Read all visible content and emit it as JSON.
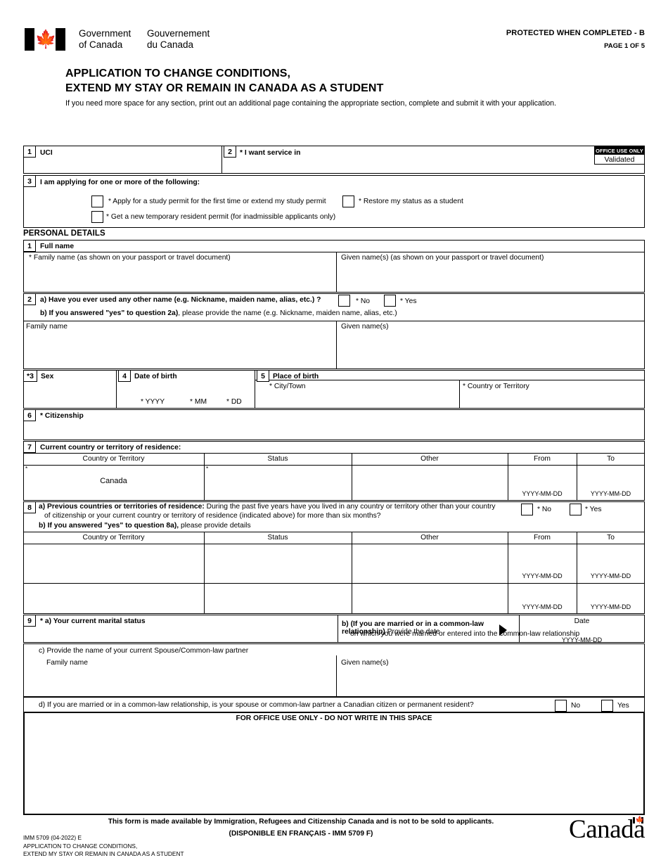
{
  "header": {
    "gov_en_line1": "Government",
    "gov_en_line2": "of Canada",
    "gov_fr_line1": "Gouvernement",
    "gov_fr_line2": "du Canada",
    "protected": "PROTECTED WHEN COMPLETED - B",
    "page_of": "PAGE 1 OF 5",
    "title_line1": "APPLICATION TO CHANGE CONDITIONS,",
    "title_line2": "EXTEND MY STAY OR REMAIN IN CANADA AS A STUDENT",
    "subnote": "If you need more space for any section, print out an additional page containing the appropriate section, complete and submit it with your application."
  },
  "office_use": {
    "strip": "OFFICE USE ONLY",
    "value": "Validated"
  },
  "top": {
    "q1_num": "1",
    "q1_label": "UCI",
    "q1_value": "",
    "q2_num": "2",
    "q2_label": "* I want service in",
    "q2_value": "",
    "q3_num": "3",
    "q3_label": "I am applying for one or more of the following:",
    "q3_options": [
      "* Apply for a study permit for the first time or extend my study permit",
      "* Restore my status as a student",
      "* Get a new temporary resident permit (for inadmissible applicants only)"
    ]
  },
  "personal_details": {
    "section_heading": "PERSONAL DETAILS",
    "q1": {
      "num": "1",
      "label": "Full name",
      "family_label": "* Family name (as shown on your passport or travel document)",
      "family_value": "",
      "given_label": "Given name(s) (as shown on your passport or travel document)",
      "given_value": ""
    },
    "q2": {
      "num": "2",
      "a_text": "a) Have you ever used any other name (e.g. Nickname, maiden name, alias, etc.) ?",
      "no_label": "* No",
      "yes_label": "* Yes",
      "b_bold": "b) If you answered \"yes\" to question 2a)",
      "b_rest": ", please provide the name (e.g. Nickname, maiden name, alias, etc.)",
      "family_label": "Family name",
      "family_value": "",
      "given_label": "Given name(s)",
      "given_value": ""
    },
    "q3": {
      "num": "*3",
      "label": "Sex",
      "value": ""
    },
    "q4": {
      "num": "4",
      "label": "Date of birth",
      "yyyy": "* YYYY",
      "mm": "* MM",
      "dd": "* DD",
      "yyyy_value": "",
      "mm_value": "",
      "dd_value": ""
    },
    "q5": {
      "num": "5",
      "label": "Place of birth",
      "city_label": "* City/Town",
      "city_value": "",
      "country_label": "* Country or Territory",
      "country_value": ""
    },
    "q6": {
      "num": "6",
      "label": "* Citizenship",
      "value": ""
    },
    "q7": {
      "num": "7",
      "label": "Current country or territory of residence:",
      "columns": [
        "Country or Territory",
        "Status",
        "Other",
        "From",
        "To"
      ],
      "row": {
        "country": "Canada",
        "status": "",
        "other": "",
        "from": "",
        "to": "",
        "from_hint": "YYYY-MM-DD",
        "to_hint": "YYYY-MM-DD"
      }
    },
    "q8": {
      "num": "8",
      "a_bold": "a) Previous countries or territories of residence:",
      "a_rest_line1": " During the past five years have you lived in any country or territory other than your country",
      "a_line2": "of citizenship or your current country or territory of residence (indicated above) for more than six months?",
      "no_label": "* No",
      "yes_label": "* Yes",
      "b_bold": "b) If you answered \"yes\" to question 8a),",
      "b_rest": " please provide details",
      "columns": [
        "Country or Territory",
        "Status",
        "Other",
        "From",
        "To"
      ],
      "rows": [
        {
          "country": "",
          "status": "",
          "other": "",
          "from": "",
          "to": "",
          "from_hint": "YYYY-MM-DD",
          "to_hint": "YYYY-MM-DD"
        },
        {
          "country": "",
          "status": "",
          "other": "",
          "from": "",
          "to": "",
          "from_hint": "YYYY-MM-DD",
          "to_hint": "YYYY-MM-DD"
        }
      ]
    },
    "q9": {
      "num": "9",
      "a_label": "* a) Your current marital status",
      "a_value": "",
      "b_bold": "b) (If you are married or in a common-law relationship)",
      "b_rest1": " Provide the date",
      "b_line2": "on which you were married or entered into the common-law relationship",
      "date_label": "Date",
      "date_value": "",
      "date_hint": "YYYY-MM-DD",
      "c_label": "c) Provide the name of your current Spouse/Common-law partner",
      "c_family_label": "Family name",
      "c_family_value": "",
      "c_given_label": "Given name(s)",
      "c_given_value": "",
      "d_label": "d) If you are married or in a common-law relationship, is your spouse or common-law partner a Canadian citizen or permanent resident?",
      "d_no": "No",
      "d_yes": "Yes"
    }
  },
  "office_block": {
    "title": "FOR OFFICE USE ONLY - DO NOT WRITE IN THIS SPACE"
  },
  "footer": {
    "line1": "This form is made available by Immigration, Refugees and Citizenship Canada and is not to be sold to applicants.",
    "line2": "(DISPONIBLE EN FRANÇAIS - IMM 5709 F)",
    "id_line1": "IMM 5709 (04-2022) E",
    "id_line2": "APPLICATION TO CHANGE CONDITIONS,",
    "id_line3": "EXTEND MY STAY OR REMAIN IN CANADA AS A STUDENT",
    "wordmark": "Canada"
  }
}
